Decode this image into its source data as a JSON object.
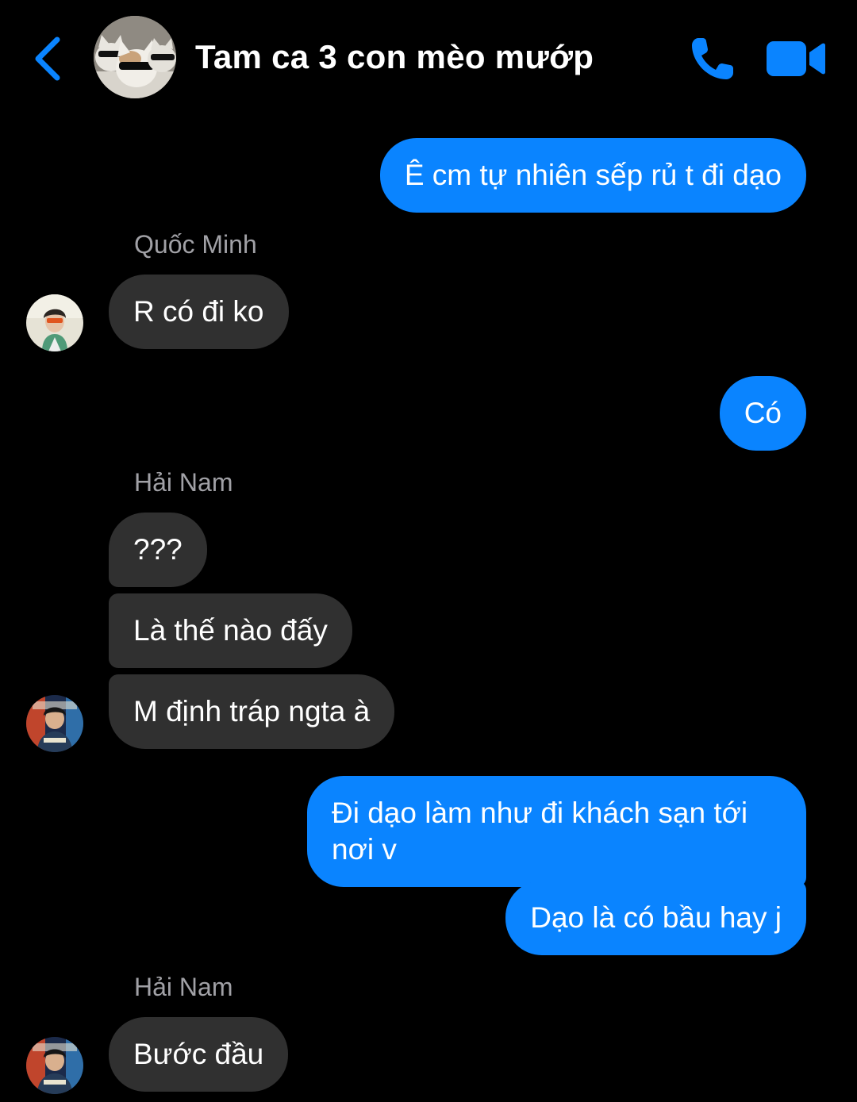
{
  "header": {
    "title": "Tam ca 3 con mèo mướp",
    "accent_color": "#0a84ff",
    "back_icon": "chevron-left-icon",
    "call_icon": "phone-icon",
    "video_icon": "video-camera-icon"
  },
  "messages": [
    {
      "direction": "outgoing",
      "text": "Ê cm tự nhiên sếp rủ t đi dạo"
    },
    {
      "direction": "incoming",
      "sender": "Quốc Minh",
      "text": "R có đi ko"
    },
    {
      "direction": "outgoing",
      "text": "Có"
    },
    {
      "direction": "incoming",
      "sender": "Hải Nam",
      "text": "???"
    },
    {
      "direction": "incoming",
      "text": "Là thế nào đấy"
    },
    {
      "direction": "incoming",
      "text": "M định tráp ngta à"
    },
    {
      "direction": "outgoing",
      "text": "Đi dạo làm như đi khách sạn tới nơi v"
    },
    {
      "direction": "outgoing",
      "text": "Dạo là có bầu hay j"
    },
    {
      "direction": "incoming",
      "sender": "Hải Nam",
      "text": "Bước đầu"
    }
  ],
  "colors": {
    "background": "#000000",
    "outgoing_bubble": "#0a84ff",
    "incoming_bubble": "#303030",
    "sender_name": "#a1a1a6"
  }
}
